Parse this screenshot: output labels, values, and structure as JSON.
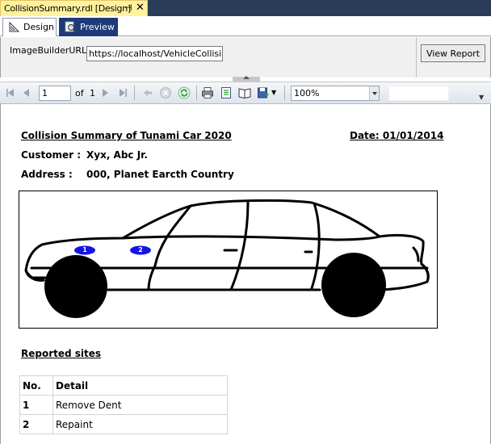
{
  "document_tab": {
    "title": "CollisionSummary.rdl [Design]",
    "pin_glyph": "⊣",
    "close_glyph": "✕"
  },
  "view_tabs": [
    {
      "label": "Design",
      "icon": "design-ruler-icon",
      "active": false
    },
    {
      "label": "Preview",
      "icon": "preview-magnifier-icon",
      "active": true
    }
  ],
  "parameters": {
    "label": "ImageBuilderURL",
    "value": "https://localhost/VehicleCollisionCe",
    "view_report_label": "View Report"
  },
  "toolbar": {
    "current_page": "1",
    "of_label": "of",
    "total_pages": "1",
    "zoom": "100%",
    "icons": [
      "first-page-icon",
      "previous-page-icon",
      "next-page-icon",
      "last-page-icon",
      "back-icon",
      "stop-icon",
      "refresh-icon",
      "print-icon",
      "print-layout-icon",
      "page-setup-icon",
      "export-icon"
    ]
  },
  "report": {
    "title": "Collision Summary of Tunami Car 2020",
    "date_label": "Date: 01/01/2014",
    "customer_label": "Customer :",
    "customer_value": "Xyx, Abc Jr.",
    "address_label": "Address :",
    "address_value": "000, Planet Earcth Country",
    "markers": [
      "1",
      "2"
    ],
    "sites_heading": "Reported sites",
    "table": {
      "headers": [
        "No.",
        "Detail"
      ],
      "rows": [
        {
          "no": "1",
          "detail": "Remove Dent"
        },
        {
          "no": "2",
          "detail": "Repaint"
        }
      ]
    }
  },
  "colors": {
    "doc_tab": "#fff29d",
    "title_bar": "#2b3c59",
    "preview_tab": "#1e3a78",
    "marker_blue": "#1414e6",
    "toolbar_green": "#2e9b3a"
  }
}
